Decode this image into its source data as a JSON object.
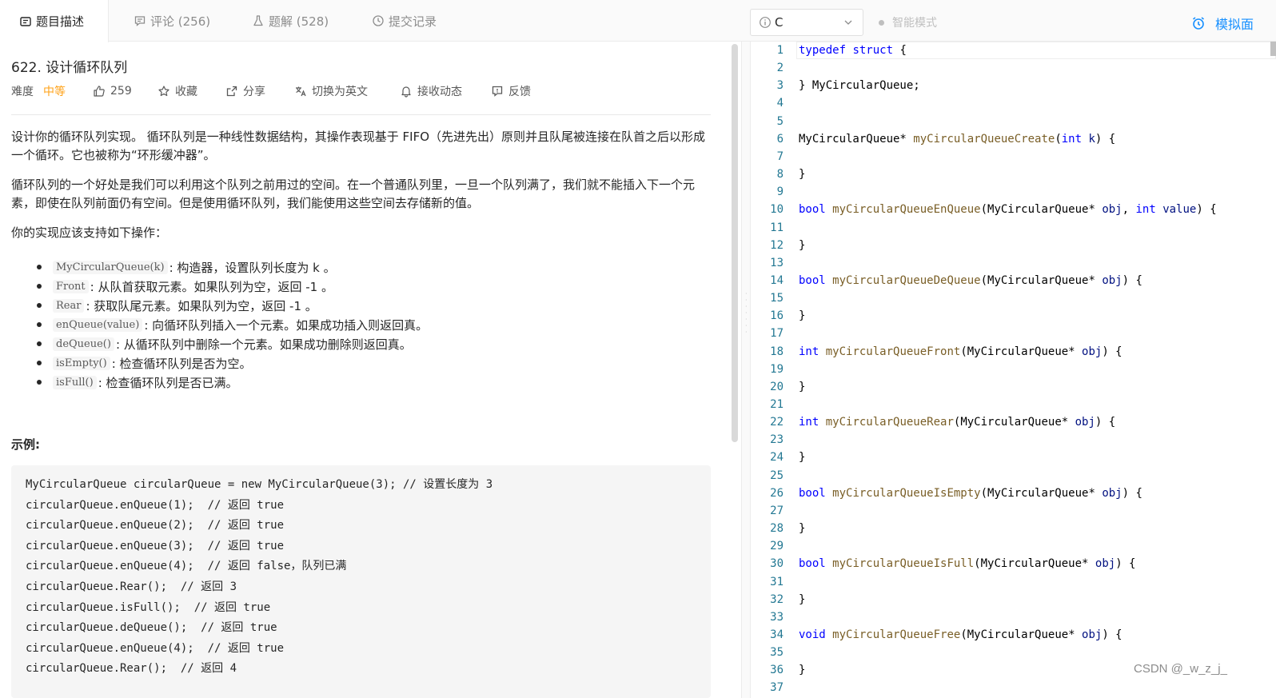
{
  "tabs": [
    {
      "label": "题目描述",
      "icon": "document-icon",
      "active": true
    },
    {
      "label": "评论 (256)",
      "icon": "comment-icon",
      "active": false
    },
    {
      "label": "题解 (528)",
      "icon": "flask-icon",
      "active": false
    },
    {
      "label": "提交记录",
      "icon": "clock-icon",
      "active": false
    }
  ],
  "problem": {
    "title": "622. 设计循环队列",
    "difficulty_label": "难度",
    "difficulty": "中等",
    "likes": "259",
    "actions": {
      "favorite": "收藏",
      "share": "分享",
      "switch_lang": "切换为英文",
      "notify": "接收动态",
      "feedback": "反馈"
    },
    "paragraphs": [
      "设计你的循环队列实现。 循环队列是一种线性数据结构，其操作表现基于 FIFO（先进先出）原则并且队尾被连接在队首之后以形成一个循环。它也被称为“环形缓冲器”。",
      "循环队列的一个好处是我们可以利用这个队列之前用过的空间。在一个普通队列里，一旦一个队列满了，我们就不能插入下一个元素，即使在队列前面仍有空间。但是使用循环队列，我们能使用这些空间去存储新的值。",
      "你的实现应该支持如下操作："
    ],
    "operations": [
      {
        "code": "MyCircularQueue(k)",
        "text": ": 构造器，设置队列长度为 k 。"
      },
      {
        "code": "Front",
        "text": ": 从队首获取元素。如果队列为空，返回 -1 。"
      },
      {
        "code": "Rear",
        "text": ": 获取队尾元素。如果队列为空，返回 -1 。"
      },
      {
        "code": "enQueue(value)",
        "text": ": 向循环队列插入一个元素。如果成功插入则返回真。"
      },
      {
        "code": "deQueue()",
        "text": ": 从循环队列中删除一个元素。如果成功删除则返回真。"
      },
      {
        "code": "isEmpty()",
        "text": ": 检查循环队列是否为空。"
      },
      {
        "code": "isFull()",
        "text": ": 检查循环队列是否已满。"
      }
    ],
    "example_label": "示例:",
    "example_lines": [
      "MyCircularQueue circularQueue = new MyCircularQueue(3); // 设置长度为 3",
      "circularQueue.enQueue(1);  // 返回 true",
      "circularQueue.enQueue(2);  // 返回 true",
      "circularQueue.enQueue(3);  // 返回 true",
      "circularQueue.enQueue(4);  // 返回 false，队列已满",
      "circularQueue.Rear();  // 返回 3",
      "circularQueue.isFull();  // 返回 true",
      "circularQueue.deQueue();  // 返回 true",
      "circularQueue.enQueue(4);  // 返回 true",
      "circularQueue.Rear();  // 返回 4"
    ]
  },
  "toolbar": {
    "language": "C",
    "smart_mode": "智能模式",
    "mock_interview": "模拟面"
  },
  "editor": {
    "lines": [
      [
        [
          "kw",
          "typedef"
        ],
        [
          "t",
          " "
        ],
        [
          "kw",
          "struct"
        ],
        [
          "t",
          " {"
        ]
      ],
      [],
      [
        [
          "t",
          "} MyCircularQueue;"
        ]
      ],
      [],
      [],
      [
        [
          "t",
          "MyCircularQueue* "
        ],
        [
          "fn",
          "myCircularQueueCreate"
        ],
        [
          "t",
          "("
        ],
        [
          "kw",
          "int"
        ],
        [
          "t",
          " "
        ],
        [
          "pm",
          "k"
        ],
        [
          "t",
          ") {"
        ]
      ],
      [],
      [
        [
          "t",
          "}"
        ]
      ],
      [],
      [
        [
          "kw",
          "bool"
        ],
        [
          "t",
          " "
        ],
        [
          "fn",
          "myCircularQueueEnQueue"
        ],
        [
          "t",
          "(MyCircularQueue* "
        ],
        [
          "pm",
          "obj"
        ],
        [
          "t",
          ", "
        ],
        [
          "kw",
          "int"
        ],
        [
          "t",
          " "
        ],
        [
          "pm",
          "value"
        ],
        [
          "t",
          ") {"
        ]
      ],
      [],
      [
        [
          "t",
          "}"
        ]
      ],
      [],
      [
        [
          "kw",
          "bool"
        ],
        [
          "t",
          " "
        ],
        [
          "fn",
          "myCircularQueueDeQueue"
        ],
        [
          "t",
          "(MyCircularQueue* "
        ],
        [
          "pm",
          "obj"
        ],
        [
          "t",
          ") {"
        ]
      ],
      [],
      [
        [
          "t",
          "}"
        ]
      ],
      [],
      [
        [
          "kw",
          "int"
        ],
        [
          "t",
          " "
        ],
        [
          "fn",
          "myCircularQueueFront"
        ],
        [
          "t",
          "(MyCircularQueue* "
        ],
        [
          "pm",
          "obj"
        ],
        [
          "t",
          ") {"
        ]
      ],
      [],
      [
        [
          "t",
          "}"
        ]
      ],
      [],
      [
        [
          "kw",
          "int"
        ],
        [
          "t",
          " "
        ],
        [
          "fn",
          "myCircularQueueRear"
        ],
        [
          "t",
          "(MyCircularQueue* "
        ],
        [
          "pm",
          "obj"
        ],
        [
          "t",
          ") {"
        ]
      ],
      [],
      [
        [
          "t",
          "}"
        ]
      ],
      [],
      [
        [
          "kw",
          "bool"
        ],
        [
          "t",
          " "
        ],
        [
          "fn",
          "myCircularQueueIsEmpty"
        ],
        [
          "t",
          "(MyCircularQueue* "
        ],
        [
          "pm",
          "obj"
        ],
        [
          "t",
          ") {"
        ]
      ],
      [],
      [
        [
          "t",
          "}"
        ]
      ],
      [],
      [
        [
          "kw",
          "bool"
        ],
        [
          "t",
          " "
        ],
        [
          "fn",
          "myCircularQueueIsFull"
        ],
        [
          "t",
          "(MyCircularQueue* "
        ],
        [
          "pm",
          "obj"
        ],
        [
          "t",
          ") {"
        ]
      ],
      [],
      [
        [
          "t",
          "}"
        ]
      ],
      [],
      [
        [
          "kw",
          "void"
        ],
        [
          "t",
          " "
        ],
        [
          "fn",
          "myCircularQueueFree"
        ],
        [
          "t",
          "(MyCircularQueue* "
        ],
        [
          "pm",
          "obj"
        ],
        [
          "t",
          ") {"
        ]
      ],
      [],
      [
        [
          "t",
          "}"
        ]
      ],
      []
    ],
    "line_numbers": [
      "1",
      "2",
      "3",
      "4",
      "5",
      "6",
      "7",
      "8",
      "9",
      "10",
      "11",
      "12",
      "13",
      "14",
      "15",
      "16",
      "17",
      "18",
      "19",
      "20",
      "21",
      "22",
      "23",
      "24",
      "25",
      "26",
      "27",
      "28",
      "29",
      "30",
      "31",
      "32",
      "33",
      "34",
      "35",
      "36",
      "37"
    ]
  },
  "watermark": "CSDN @_w_z_j_",
  "colors": {
    "accent": "#1890ff",
    "difficulty_medium": "#ffa116",
    "keyword": "#0000ff",
    "function": "#795e26",
    "param": "#001080",
    "line_number": "#237893"
  }
}
